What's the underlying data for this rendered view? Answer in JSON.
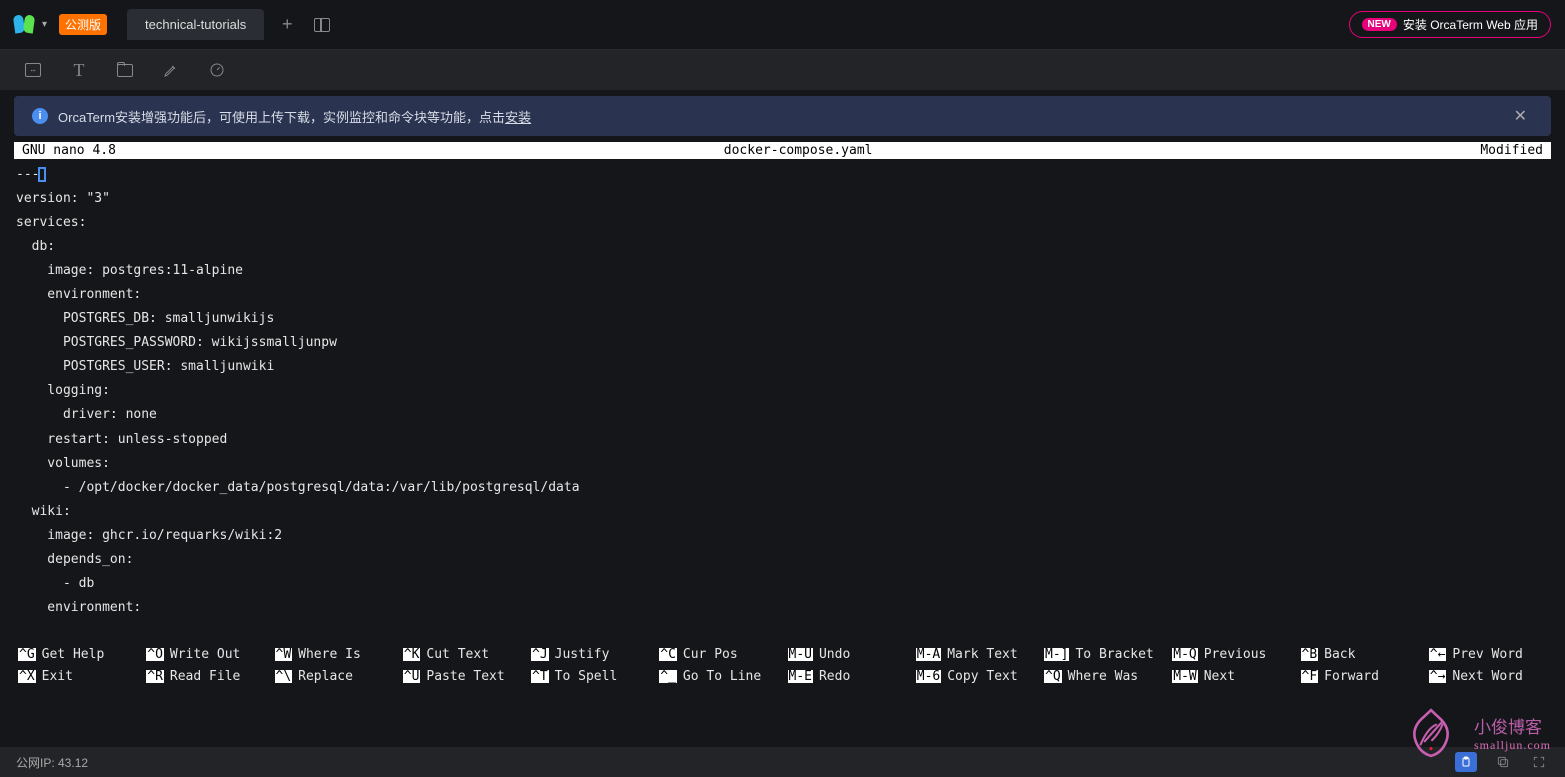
{
  "topbar": {
    "beta_label": "公测版",
    "tab_title": "technical-tutorials",
    "install_new": "NEW",
    "install_label": "安装 OrcaTerm Web 应用"
  },
  "banner": {
    "text_prefix": "OrcaTerm安装增强功能后，可使用上传下载，实例监控和命令块等功能，点击",
    "link": "安装"
  },
  "nano": {
    "app": "  GNU nano 4.8",
    "filename": "docker-compose.yaml",
    "status": "Modified  "
  },
  "editor_lines": [
    "---",
    "version: \"3\"",
    "services:",
    "  db:",
    "    image: postgres:11-alpine",
    "    environment:",
    "      POSTGRES_DB: smalljunwikijs",
    "      POSTGRES_PASSWORD: wikijssmalljunpw",
    "      POSTGRES_USER: smalljunwiki",
    "    logging:",
    "      driver: none",
    "    restart: unless-stopped",
    "    volumes:",
    "      - /opt/docker/docker_data/postgresql/data:/var/lib/postgresql/data",
    "  wiki:",
    "    image: ghcr.io/requarks/wiki:2",
    "    depends_on:",
    "      - db",
    "    environment:"
  ],
  "help": [
    {
      "k": "^G",
      "l": "Get Help"
    },
    {
      "k": "^O",
      "l": "Write Out"
    },
    {
      "k": "^W",
      "l": "Where Is"
    },
    {
      "k": "^K",
      "l": "Cut Text"
    },
    {
      "k": "^J",
      "l": "Justify"
    },
    {
      "k": "^C",
      "l": "Cur Pos"
    },
    {
      "k": "M-U",
      "l": "Undo"
    },
    {
      "k": "M-A",
      "l": "Mark Text"
    },
    {
      "k": "M-]",
      "l": "To Bracket"
    },
    {
      "k": "M-Q",
      "l": "Previous"
    },
    {
      "k": "^B",
      "l": "Back"
    },
    {
      "k": "^←",
      "l": "Prev Word"
    },
    {
      "k": "^X",
      "l": "Exit"
    },
    {
      "k": "^R",
      "l": "Read File"
    },
    {
      "k": "^\\",
      "l": "Replace"
    },
    {
      "k": "^U",
      "l": "Paste Text"
    },
    {
      "k": "^T",
      "l": "To Spell"
    },
    {
      "k": "^_",
      "l": "Go To Line"
    },
    {
      "k": "M-E",
      "l": "Redo"
    },
    {
      "k": "M-6",
      "l": "Copy Text"
    },
    {
      "k": "^Q",
      "l": "Where Was"
    },
    {
      "k": "M-W",
      "l": "Next"
    },
    {
      "k": "^F",
      "l": "Forward"
    },
    {
      "k": "^→",
      "l": "Next Word"
    }
  ],
  "statusbar": {
    "ip_label": "公网IP: 43.12"
  },
  "watermark": {
    "line1": "小俊博客",
    "line2": "smalljun.com"
  }
}
